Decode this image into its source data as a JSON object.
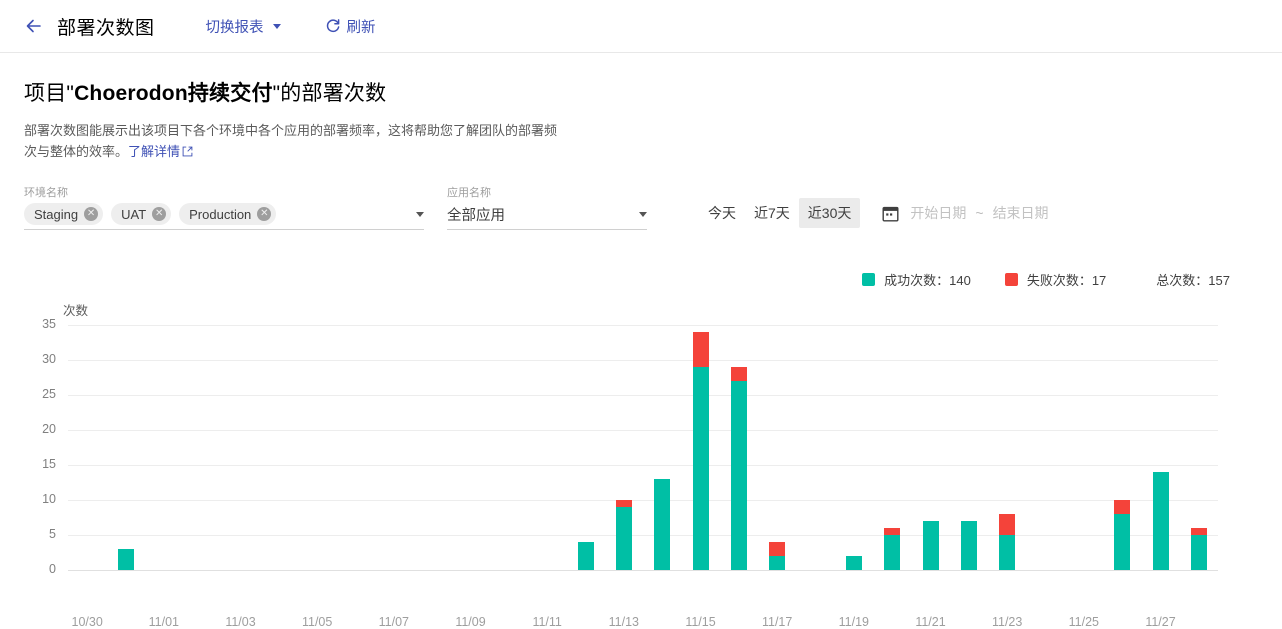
{
  "topbar": {
    "back_icon": "arrow-left-icon",
    "title": "部署次数图",
    "switch_report_label": "切换报表",
    "refresh_label": "刷新",
    "refresh_icon": "refresh-icon",
    "dropdown_icon": "caret-down-icon"
  },
  "heading": {
    "title_prefix": "项目\"",
    "title_emphasis": "Choerodon持续交付",
    "title_suffix": "\"的部署次数",
    "title_full": "项目\"Choerodon持续交付\"的部署次数",
    "description": "部署次数图能展示出该项目下各个环境中各个应用的部署频率，这将帮助您了解团队的部署频次与整体的效率。",
    "link_label": "了解详情",
    "link_icon": "external-link-icon"
  },
  "filters": {
    "env": {
      "label": "环境名称",
      "chips": [
        "Staging",
        "UAT",
        "Production"
      ],
      "remove_icon": "close-circle-icon",
      "dropdown_icon": "caret-down-icon"
    },
    "app": {
      "label": "应用名称",
      "value": "全部应用",
      "dropdown_icon": "caret-down-icon"
    },
    "ranges": [
      {
        "label": "今天",
        "active": false
      },
      {
        "label": "近7天",
        "active": false
      },
      {
        "label": "近30天",
        "active": true
      }
    ],
    "date_picker": {
      "icon": "calendar-icon",
      "start_placeholder": "开始日期",
      "separator": "~",
      "end_placeholder": "结束日期"
    }
  },
  "legend": {
    "success_label": "成功次数：140",
    "success_color": "#00bfa5",
    "fail_label": "失败次数：17",
    "fail_color": "#f4433a",
    "total_label": "总次数：157"
  },
  "chart_data": {
    "type": "bar",
    "stacked": true,
    "title": "",
    "xlabel": "",
    "ylabel": "次数",
    "ylim": [
      0,
      35
    ],
    "yticks": [
      0,
      5,
      10,
      15,
      20,
      25,
      30,
      35
    ],
    "grid": true,
    "legend_position": "top-right",
    "x": [
      "10/30",
      "10/31",
      "11/01",
      "11/02",
      "11/03",
      "11/04",
      "11/05",
      "11/06",
      "11/07",
      "11/08",
      "11/09",
      "11/10",
      "11/11",
      "11/12",
      "11/13",
      "11/14",
      "11/15",
      "11/16",
      "11/17",
      "11/18",
      "11/19",
      "11/20",
      "11/21",
      "11/22",
      "11/23",
      "11/24",
      "11/25",
      "11/26",
      "11/27",
      "11/28"
    ],
    "tick_labels": [
      "10/30",
      "11/01",
      "11/03",
      "11/05",
      "11/07",
      "11/09",
      "11/11",
      "11/13",
      "11/15",
      "11/17",
      "11/19",
      "11/21",
      "11/23",
      "11/25",
      "11/27"
    ],
    "series": [
      {
        "name": "成功次数",
        "color": "#00bfa5",
        "values": [
          0,
          3,
          0,
          0,
          0,
          0,
          0,
          0,
          0,
          0,
          0,
          0,
          0,
          4,
          9,
          13,
          29,
          27,
          2,
          0,
          2,
          5,
          7,
          7,
          5,
          0,
          0,
          8,
          14,
          5
        ]
      },
      {
        "name": "失败次数",
        "color": "#f4433a",
        "values": [
          0,
          0,
          0,
          0,
          0,
          0,
          0,
          0,
          0,
          0,
          0,
          0,
          0,
          0,
          1,
          0,
          5,
          2,
          2,
          0,
          0,
          1,
          0,
          0,
          3,
          0,
          0,
          2,
          0,
          1
        ]
      }
    ],
    "totals": [
      0,
      3,
      0,
      0,
      0,
      0,
      0,
      0,
      0,
      0,
      0,
      0,
      0,
      4,
      10,
      13,
      34,
      29,
      4,
      0,
      2,
      6,
      7,
      7,
      8,
      0,
      0,
      10,
      14,
      6
    ]
  }
}
